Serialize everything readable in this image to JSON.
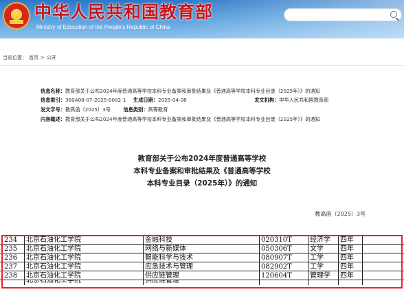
{
  "header": {
    "title": "中华人民共和国教育部",
    "subtitle": "Ministry of Education of the People's Republic of China",
    "search_placeholder": ""
  },
  "breadcrumb": {
    "prefix": "当前位置：",
    "home": "首页",
    "sep": ">",
    "current": "公开"
  },
  "meta": {
    "info_name_label": "信息名称：",
    "info_name": "教育部关于公布2024年度普通高等学校本科专业备案和审批结果及《普通高等学校本科专业目录（2025年）》的通知",
    "index_label": "信息索引：",
    "index": "360A08-07-2025-0002-1",
    "date_label": "生成日期：",
    "date": "2025-04-08",
    "org_label": "发文机构：",
    "org": "中华人民共和国教育部",
    "docno_label": "发文字号：",
    "docno": "教高函〔2025〕3号",
    "category_label": "信息类别：",
    "category": "高等教育",
    "summary_label": "内容概述：",
    "summary": "教育部关于公布2024年度普通高等学校本科专业备案和审批结果及《普通高等学校本科专业目录（2025年）》的通知"
  },
  "announcement": {
    "line1": "教育部关于公布2024年度普通高等学校",
    "line2": "本科专业备案和审批结果及《普通高等学校",
    "line3": "本科专业目录（2025年）》的通知",
    "doc_number": "教高函〔2025〕3号"
  },
  "table": {
    "rows": [
      [
        "234",
        "北京石油化工学院",
        "金融科技",
        "020310T",
        "经济学",
        "四年",
        ""
      ],
      [
        "235",
        "北京石油化工学院",
        "网络与新媒体",
        "050306T",
        "文学",
        "四年",
        ""
      ],
      [
        "236",
        "北京石油化工学院",
        "智能科学与技术",
        "080907T",
        "工学",
        "四年",
        ""
      ],
      [
        "237",
        "北京石油化工学院",
        "应急技术与管理",
        "082902T",
        "工学",
        "四年",
        ""
      ],
      [
        "238",
        "北京石油化工学院",
        "供应链管理",
        "120604T",
        "管理学",
        "四年",
        ""
      ]
    ],
    "partial_row": [
      "",
      "北京石油化工学院",
      "供应链管理",
      "",
      "",
      "",
      ""
    ]
  },
  "colors": {
    "highlight": "#e8232a",
    "title_red": "#c8151b",
    "header_blue": "#2c78c6"
  }
}
